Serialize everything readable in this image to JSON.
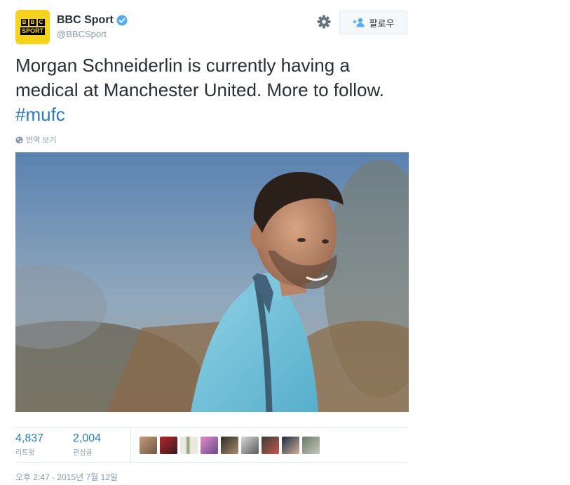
{
  "author": {
    "display_name": "BBC Sport",
    "screen_name": "@BBCSport",
    "logo_letters": [
      "B",
      "B",
      "C"
    ],
    "logo_sport": "SPORT",
    "verified": true
  },
  "follow_button": {
    "label": "팔로우",
    "icon": "add-user-icon"
  },
  "settings": {
    "icon": "gear-icon"
  },
  "tweet": {
    "text_main": "Morgan Schneiderlin is currently having a medical at Manchester United. More to follow. ",
    "hashtag": "#mufc"
  },
  "translate": {
    "label": "번역 보기",
    "icon": "globe-icon"
  },
  "stats": {
    "retweets": {
      "value": "4,837",
      "label": "리트윗"
    },
    "likes": {
      "value": "2,004",
      "label": "관심글"
    }
  },
  "timestamp": "오후 2:47 - 2015년 7월 12일",
  "colors": {
    "link": "#2b7bb9",
    "brand_yellow": "#f5d21b",
    "muted": "#8899a6"
  }
}
